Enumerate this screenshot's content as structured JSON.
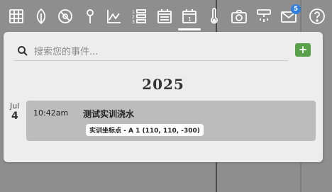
{
  "toolbar": {
    "icons": [
      {
        "name": "grid-icon"
      },
      {
        "name": "leaf-icon"
      },
      {
        "name": "no-entry-icon"
      },
      {
        "name": "pin-icon"
      },
      {
        "name": "chart-icon"
      },
      {
        "name": "numbered-list-icon"
      },
      {
        "name": "calendar-month-icon"
      },
      {
        "name": "calendar-day-icon",
        "active": true,
        "label": "1"
      },
      {
        "name": "thermometer-icon"
      },
      {
        "name": "camera-icon"
      },
      {
        "name": "sprinkler-icon"
      },
      {
        "name": "mail-icon",
        "badge": "5"
      },
      {
        "name": "help-icon"
      }
    ]
  },
  "search": {
    "placeholder": "搜索您的事件..."
  },
  "add_button": {
    "label": "+"
  },
  "timeline": {
    "year": "2025",
    "groups": [
      {
        "month": "Jul",
        "day": "4",
        "events": [
          {
            "time": "10:42am",
            "title": "测试实训浇水",
            "tag": "实训坐标点 - A 1 (110, 110, -300)"
          }
        ]
      }
    ]
  },
  "colors": {
    "background": "#8e8e8e",
    "panel": "#ededed",
    "event_card": "#bcbcbc",
    "add_button": "#58a04a",
    "badge": "#2f7fe0"
  }
}
